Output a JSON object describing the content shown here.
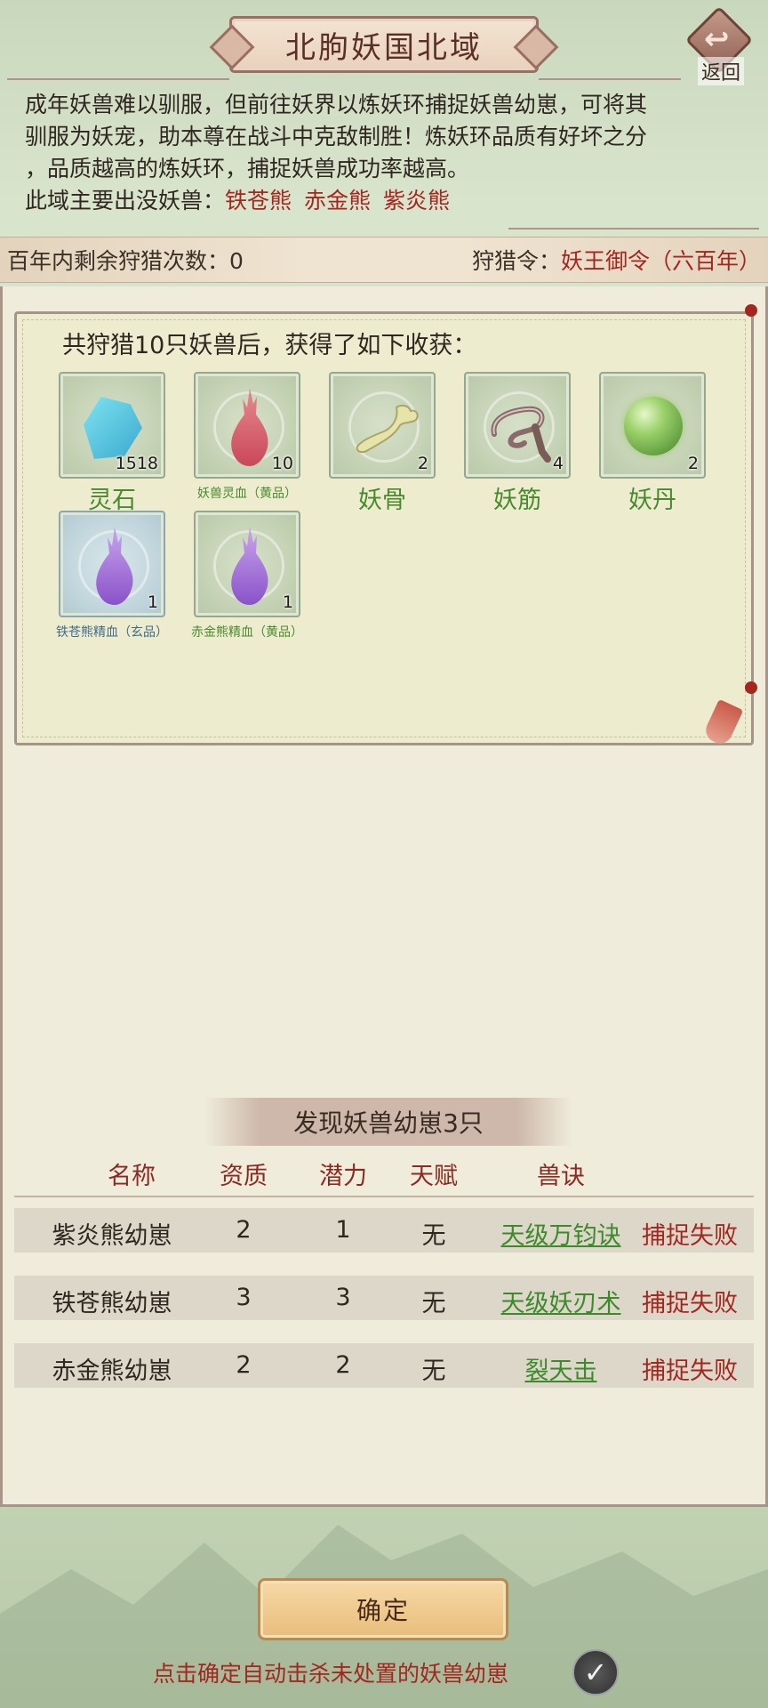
{
  "header": {
    "title": "北朐妖国北域",
    "back_label": "返回"
  },
  "description": {
    "lines": [
      "成年妖兽难以驯服，但前往妖界以炼妖环捕捉妖兽幼崽，可将其",
      "驯服为妖宠，助本尊在战斗中克敌制胜！炼妖环品质有好坏之分",
      "，品质越高的炼妖环，捕捉妖兽成功率越高。"
    ],
    "beasts_prefix": "此域主要出没妖兽：",
    "beasts": [
      "铁苍熊",
      "赤金熊",
      "紫炎熊"
    ]
  },
  "status": {
    "remaining_label": "百年内剩余狩猎次数：",
    "remaining_value": "0",
    "order_label": "狩猎令：",
    "order_value": "妖王御令（六百年）"
  },
  "harvest": {
    "title": "共狩猎10只妖兽后，获得了如下收获：",
    "items": [
      {
        "name": "灵石",
        "count": "1518",
        "icon": "spirit-stone-icon"
      },
      {
        "name": "妖兽灵血（黄品）",
        "count": "10",
        "icon": "red-blood-drop-icon"
      },
      {
        "name": "妖骨",
        "count": "2",
        "icon": "bone-icon"
      },
      {
        "name": "妖筋",
        "count": "4",
        "icon": "tendon-icon"
      },
      {
        "name": "妖丹",
        "count": "2",
        "icon": "orb-icon"
      },
      {
        "name": "铁苍熊精血（玄品）",
        "count": "1",
        "icon": "purple-blood-drop-icon"
      },
      {
        "name": "赤金熊精血（黄品）",
        "count": "1",
        "icon": "purple-blood-drop-icon"
      }
    ]
  },
  "found": {
    "title": "发现妖兽幼崽3只",
    "columns": [
      "名称",
      "资质",
      "潜力",
      "天赋",
      "兽诀"
    ],
    "rows": [
      {
        "name": "紫炎熊幼崽",
        "aptitude": "2",
        "potential": "1",
        "talent": "无",
        "skill": "天级万钧诀",
        "result": "捕捉失败"
      },
      {
        "name": "铁苍熊幼崽",
        "aptitude": "3",
        "potential": "3",
        "talent": "无",
        "skill": "天级妖刃术",
        "result": "捕捉失败"
      },
      {
        "name": "赤金熊幼崽",
        "aptitude": "2",
        "potential": "2",
        "talent": "无",
        "skill": "裂天击",
        "result": "捕捉失败"
      }
    ]
  },
  "footer": {
    "confirm_label": "确定",
    "hint": "点击确定自动击杀未处置的妖兽幼崽",
    "auto_kill_checked": true
  },
  "colors": {
    "accent_red": "#a3261f",
    "item_green": "#4a8a2e",
    "link_green": "#3c8a2a"
  }
}
